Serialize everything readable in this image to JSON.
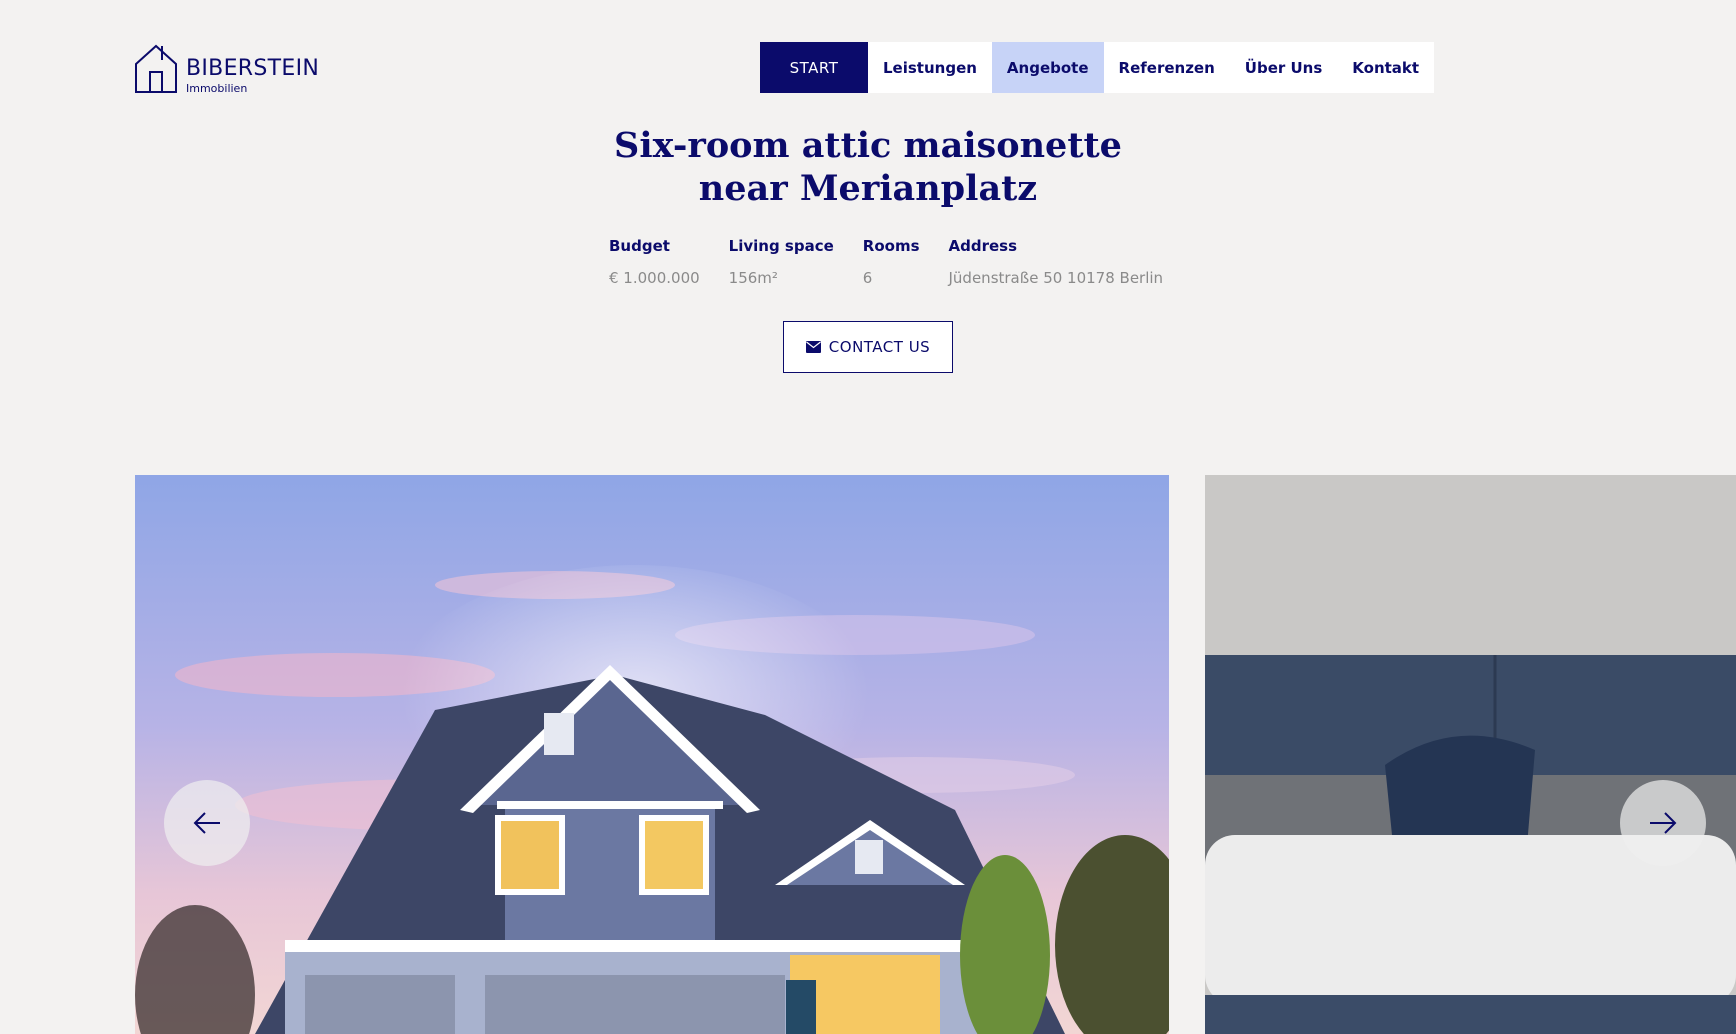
{
  "brand": {
    "name": "BIBERSTEIN",
    "sub": "Immobilien"
  },
  "nav": {
    "items": [
      {
        "label": "START"
      },
      {
        "label": "Leistungen"
      },
      {
        "label": "Angebote"
      },
      {
        "label": "Referenzen"
      },
      {
        "label": "Über Uns"
      },
      {
        "label": "Kontakt"
      }
    ]
  },
  "listing": {
    "title_line1": "Six-room attic maisonette",
    "title_line2": "near Merianplatz",
    "specs": [
      {
        "label": "Budget",
        "value": "€ 1.000.000"
      },
      {
        "label": "Living space",
        "value": "156m²"
      },
      {
        "label": "Rooms",
        "value": "6"
      },
      {
        "label": "Address",
        "value": "Jüdenstraße 50 10178 Berlin"
      }
    ],
    "contact_label": "CONTACT US"
  },
  "carousel": {
    "prev_icon": "arrow-left-icon",
    "next_icon": "arrow-right-icon"
  },
  "colors": {
    "navy": "#0b0b6b",
    "active_nav": "#c7d3f7",
    "background": "#f3f2f1"
  }
}
